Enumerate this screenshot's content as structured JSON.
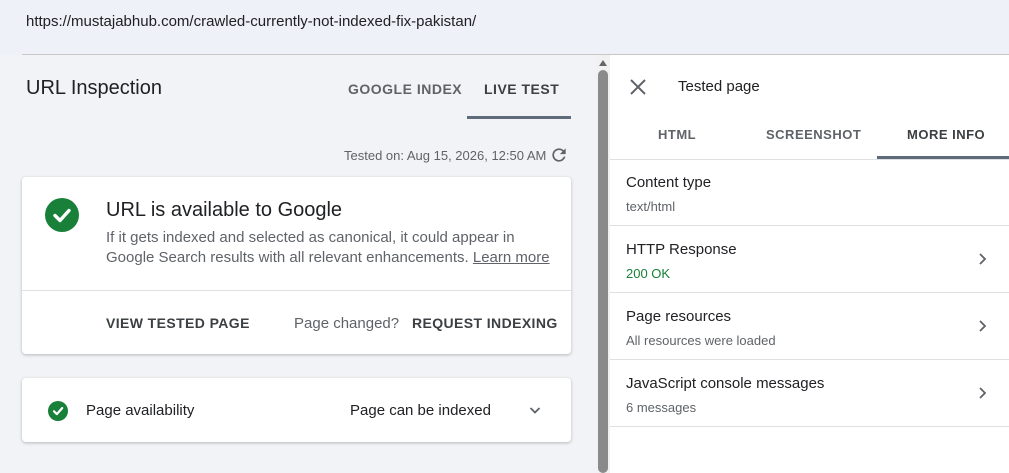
{
  "browser": {
    "url": "https://mustajabhub.com/crawled-currently-not-indexed-fix-pakistan/"
  },
  "inspection": {
    "title": "URL Inspection",
    "tabs": [
      "GOOGLE INDEX",
      "LIVE TEST"
    ],
    "active_tab": "LIVE TEST",
    "tested_on": "Tested on: Aug 15, 2026, 12:50 AM"
  },
  "status_card": {
    "title": "URL is available to Google",
    "description": "If it gets indexed and selected as canonical, it could appear in Google Search results with all relevant enhancements.",
    "learn_more": "Learn more",
    "view_tested_page": "VIEW TESTED PAGE",
    "page_changed": "Page changed?",
    "request_indexing": "REQUEST INDEXING"
  },
  "availability": {
    "label": "Page availability",
    "value": "Page can be indexed"
  },
  "tested_page": {
    "title": "Tested page",
    "tabs": [
      "HTML",
      "SCREENSHOT",
      "MORE INFO"
    ],
    "active_tab": "MORE INFO",
    "rows": [
      {
        "title": "Content type",
        "subtitle": "text/html"
      },
      {
        "title": "HTTP Response",
        "subtitle": "200 OK"
      },
      {
        "title": "Page resources",
        "subtitle": "All resources were loaded"
      },
      {
        "title": "JavaScript console messages",
        "subtitle": "6 messages"
      }
    ]
  },
  "colors": {
    "success": "#188038",
    "tab_indicator": "#5f6b7a"
  }
}
